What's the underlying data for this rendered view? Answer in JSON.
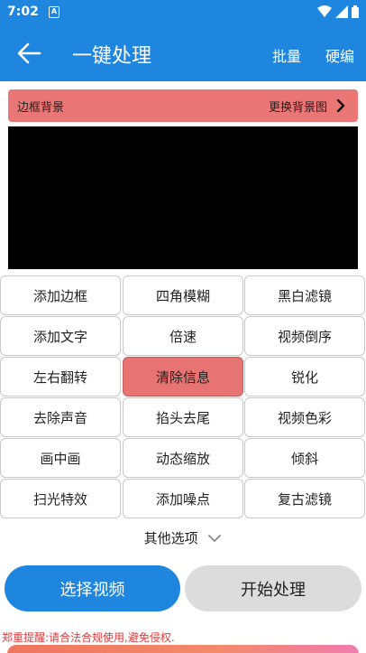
{
  "status_bar": {
    "time": "7:02",
    "notification_badge": "A"
  },
  "app_bar": {
    "title": "一键处理",
    "batch_label": "批量",
    "hard_edit_label": "硬编"
  },
  "background_row": {
    "label": "边框背景",
    "action": "更换背景图"
  },
  "tools": [
    [
      "添加边框",
      "四角模糊",
      "黑白滤镜"
    ],
    [
      "添加文字",
      "倍速",
      "视频倒序"
    ],
    [
      "左右翻转",
      "清除信息",
      "锐化"
    ],
    [
      "去除声音",
      "掐头去尾",
      "视频色彩"
    ],
    [
      "画中画",
      "动态缩放",
      "倾斜"
    ],
    [
      "扫光特效",
      "添加噪点",
      "复古滤镜"
    ]
  ],
  "selected_tool": "清除信息",
  "more_options_label": "其他选项",
  "buttons": {
    "choose_video": "选择视频",
    "start_processing": "开始处理"
  },
  "warning_text": "郑重提醒:请合法合规使用,避免侵权.",
  "colors": {
    "primary": "#1f86e0",
    "accent": "#ea7676",
    "warning": "#e23b3b"
  }
}
